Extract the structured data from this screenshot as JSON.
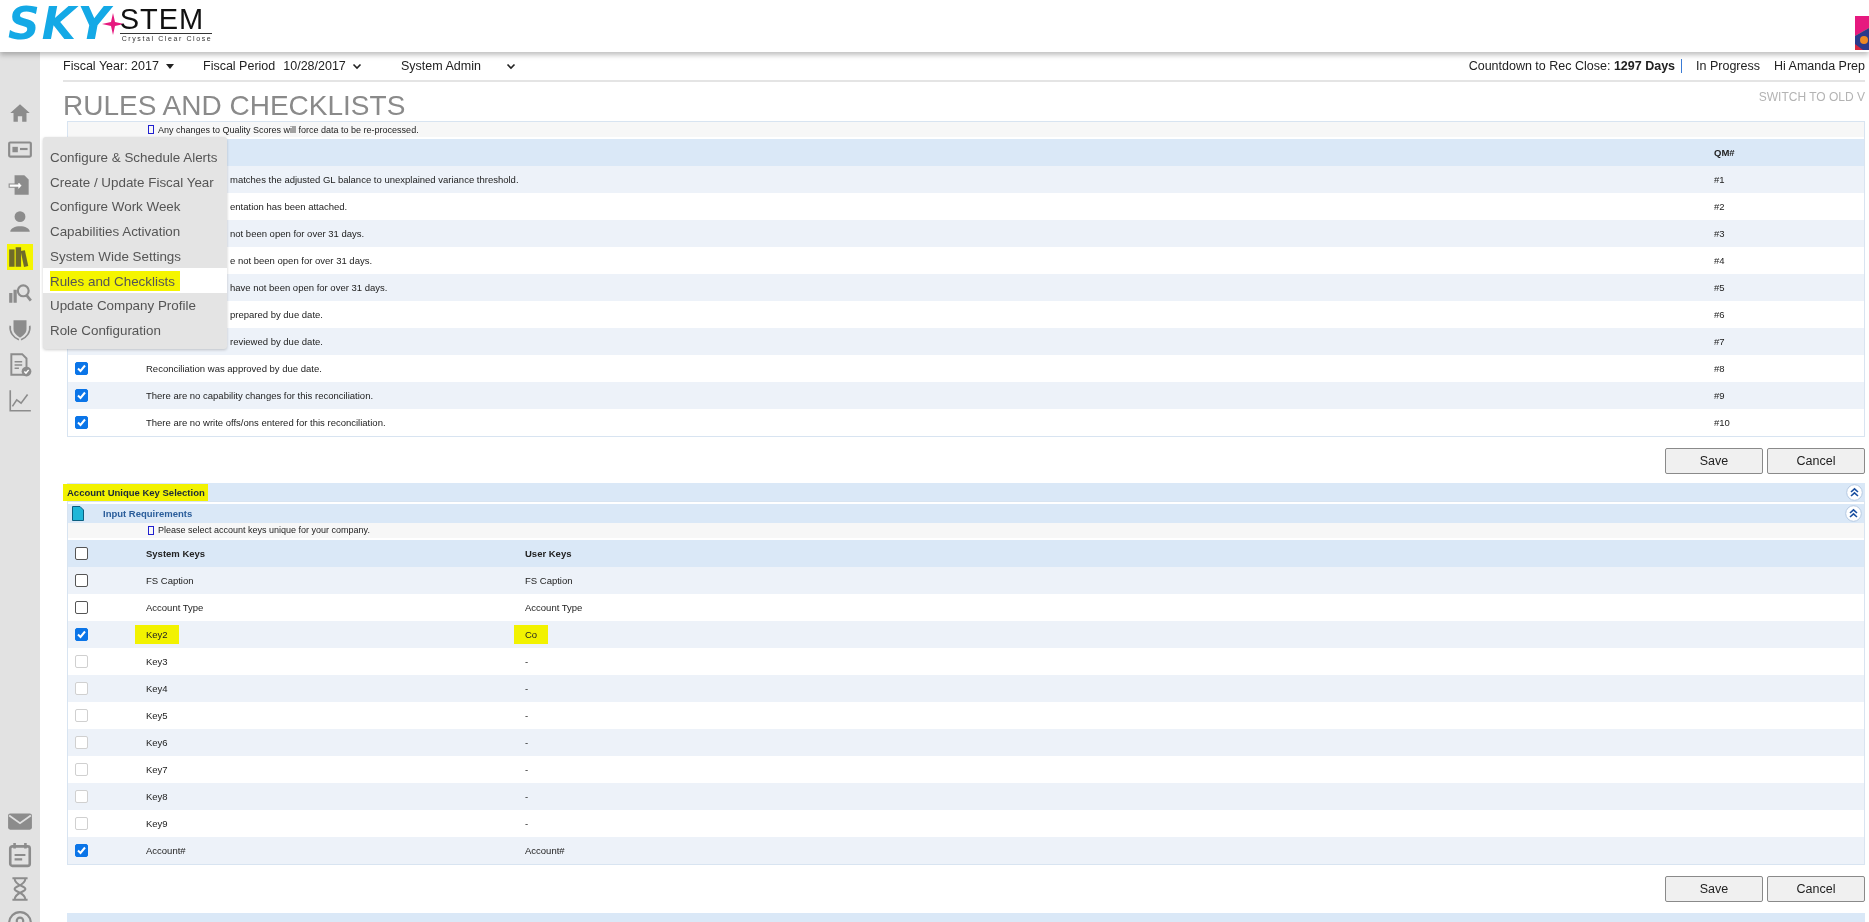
{
  "header": {
    "logo_sky": "SKY",
    "logo_stem": "STEM",
    "logo_tagline": "Crystal Clear Close"
  },
  "sidebar": {
    "top_icons": [
      {
        "kind": "home",
        "selected": false
      },
      {
        "kind": "card",
        "selected": false
      },
      {
        "kind": "import",
        "selected": false
      },
      {
        "kind": "person",
        "selected": false
      },
      {
        "kind": "books",
        "selected": true
      },
      {
        "kind": "search",
        "selected": false
      },
      {
        "kind": "shield",
        "selected": false
      },
      {
        "kind": "doc",
        "selected": false
      },
      {
        "kind": "chart",
        "selected": false
      }
    ],
    "bottom_icons": [
      {
        "kind": "mail",
        "selected": false
      },
      {
        "kind": "calendar",
        "selected": false
      },
      {
        "kind": "hourglass",
        "selected": false
      },
      {
        "kind": "pin",
        "selected": false
      }
    ]
  },
  "toolbar": {
    "fiscal_year": "Fiscal Year: 2017",
    "fiscal_period_label": "Fiscal Period",
    "fiscal_period": "10/28/2017",
    "role": "System Admin",
    "countdown": "Countdown to Rec Close: **1297 Days**",
    "status": "In Progress",
    "greeting": "Hi Amanda Prep"
  },
  "page_title": "RULES AND CHECKLISTS",
  "switch_link": "SWITCH TO OLD V",
  "menu": {
    "items": [
      {
        "label": "Configure & Schedule Alerts",
        "selected": false
      },
      {
        "label": "Create / Update Fiscal Year",
        "selected": false
      },
      {
        "label": "Configure Work Week",
        "selected": false
      },
      {
        "label": "Capabilities Activation",
        "selected": false
      },
      {
        "label": "System Wide Settings",
        "selected": false
      },
      {
        "label": "Rules and Checklists",
        "selected": true
      },
      {
        "label": "Update Company Profile",
        "selected": false
      },
      {
        "label": "Role Configuration",
        "selected": false
      }
    ]
  },
  "quality_panel": {
    "note": "Any changes to Quality Scores will force data to be re-processed.",
    "qm_column": "QM#",
    "rows": [
      {
        "text": "matches the adjusted GL balance to unexplained variance threshold.",
        "qm": "#1",
        "clipped": true
      },
      {
        "text": "entation has been attached.",
        "qm": "#2",
        "clipped": true
      },
      {
        "text": "not been open for over 31 days.",
        "qm": "#3",
        "clipped": true
      },
      {
        "text": "e not been open for over 31 days.",
        "qm": "#4",
        "clipped": true
      },
      {
        "text": "have not been open for over 31 days.",
        "qm": "#5",
        "clipped": true
      },
      {
        "text": "prepared by due date.",
        "qm": "#6",
        "clipped": true
      },
      {
        "text": "reviewed by due date.",
        "qm": "#7",
        "clipped": true
      },
      {
        "text": "Reconciliation was approved by due date.",
        "qm": "#8",
        "clipped": false,
        "checked": true
      },
      {
        "text": "There are no capability changes for this reconciliation.",
        "qm": "#9",
        "clipped": false,
        "checked": true
      },
      {
        "text": "There are no write offs/ons entered for this reconciliation.",
        "qm": "#10",
        "clipped": false,
        "checked": true
      }
    ],
    "buttons": [
      "Save",
      "Cancel"
    ]
  },
  "key_section": {
    "title": "Account Unique Key Selection",
    "title_highlighted": true,
    "subsection": "Input Requirements",
    "note": "Please select account keys unique for your company.",
    "header_checked": false,
    "columns": [
      "System Keys",
      "User Keys"
    ],
    "rows": [
      {
        "system_key": "FS Caption",
        "user_key": "FS Caption",
        "checked": false,
        "disabled": false,
        "highlighted": false
      },
      {
        "system_key": "Account Type",
        "user_key": "Account Type",
        "checked": false,
        "disabled": false,
        "highlighted": false
      },
      {
        "system_key": "Key2",
        "user_key": "Co",
        "checked": true,
        "disabled": false,
        "highlighted": true
      },
      {
        "system_key": "Key3",
        "user_key": "-",
        "checked": false,
        "disabled": true,
        "highlighted": false
      },
      {
        "system_key": "Key4",
        "user_key": "-",
        "checked": false,
        "disabled": true,
        "highlighted": false
      },
      {
        "system_key": "Key5",
        "user_key": "-",
        "checked": false,
        "disabled": true,
        "highlighted": false
      },
      {
        "system_key": "Key6",
        "user_key": "-",
        "checked": false,
        "disabled": true,
        "highlighted": false
      },
      {
        "system_key": "Key7",
        "user_key": "-",
        "checked": false,
        "disabled": true,
        "highlighted": false
      },
      {
        "system_key": "Key8",
        "user_key": "-",
        "checked": false,
        "disabled": true,
        "highlighted": false
      },
      {
        "system_key": "Key9",
        "user_key": "-",
        "checked": false,
        "disabled": true,
        "highlighted": false
      },
      {
        "system_key": "Account#",
        "user_key": "Account#",
        "checked": true,
        "disabled": false,
        "highlighted": false
      }
    ],
    "buttons": [
      "Save",
      "Cancel"
    ]
  }
}
